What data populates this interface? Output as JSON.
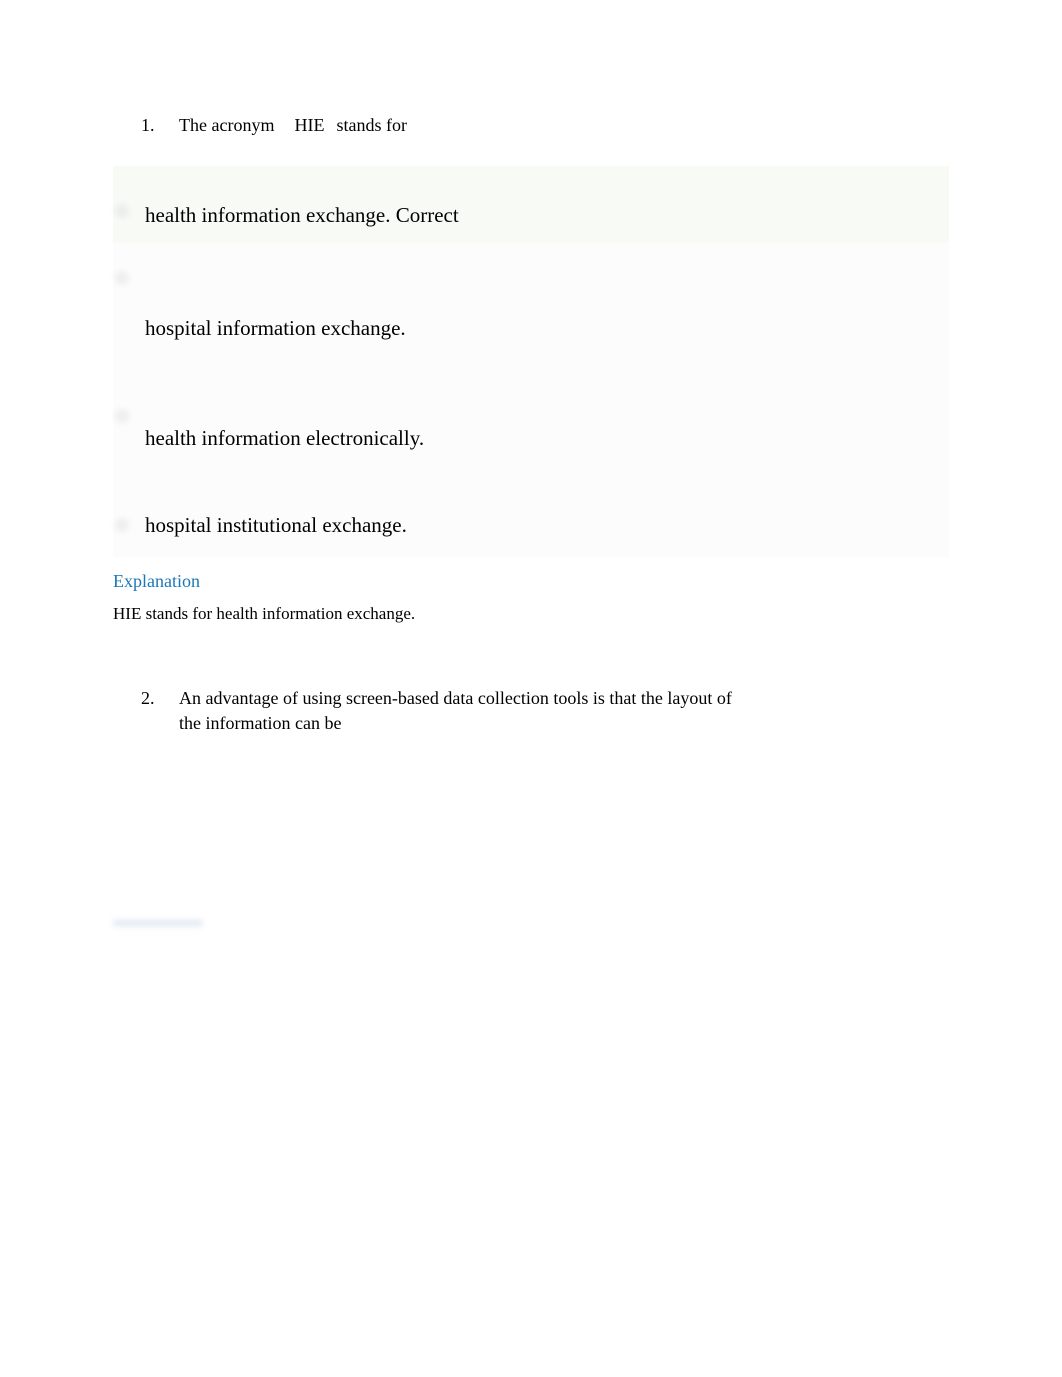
{
  "q1": {
    "number": "1.",
    "text_prefix": "The acronym",
    "text_term": "HIE",
    "text_suffix": "stands for",
    "options": {
      "a": "health information exchange. Correct",
      "b": "hospital information exchange.",
      "c": "health information electronically.",
      "d": "hospital institutional exchange."
    },
    "explanation_heading": "Explanation",
    "explanation_body": "HIE stands for health information exchange."
  },
  "q2": {
    "number": "2.",
    "text": "An advantage of using screen-based data collection tools is that the layout of the information can be"
  }
}
